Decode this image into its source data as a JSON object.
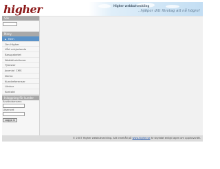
{
  "header": {
    "logo_text": "higher",
    "site_title": "Higher webbutveckling",
    "tagline": "..hjälper ditt företag att nå högre!"
  },
  "search": {
    "heading": "Sök",
    "placeholder": ""
  },
  "menu": {
    "heading": "Meny",
    "items": [
      {
        "label": "Hem"
      },
      {
        "label": "Om Higher"
      },
      {
        "label": "Vårt erbjudande"
      },
      {
        "label": "Basspaketet"
      },
      {
        "label": "Webbfunktioner"
      },
      {
        "label": "Tjänster"
      },
      {
        "label": "Joomla! CMS"
      },
      {
        "label": "Demo"
      },
      {
        "label": "Kundreferenser"
      },
      {
        "label": "Länkar"
      },
      {
        "label": "Kontakt"
      }
    ]
  },
  "login": {
    "heading": "Inloggning för kunder",
    "username_label": "Användarnamn",
    "password_label": "Lösenord",
    "button_label": "Logga in"
  },
  "footer": {
    "prefix": "© 2007 Higher webbutveckling. Allt innehåll på ",
    "link": "www.higher.se",
    "suffix": " är skyddat enligt lagen om upphovsrätt."
  },
  "colors": {
    "active_menu": "#5a92c8",
    "box_heading": "#a9a9a9",
    "logo": "#8c1a1a"
  }
}
